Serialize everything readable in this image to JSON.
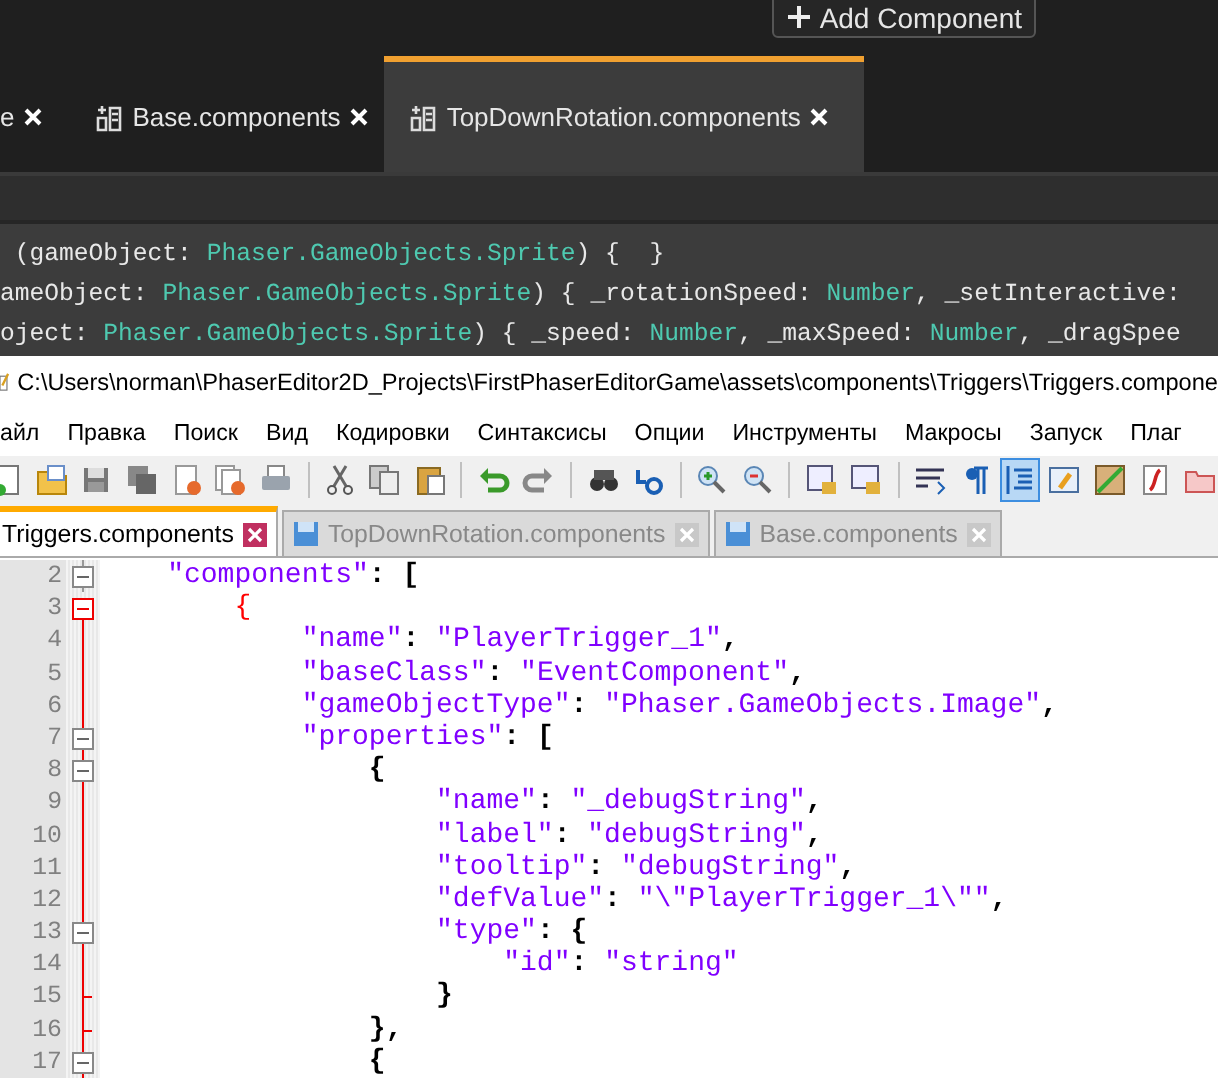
{
  "phaser": {
    "add_button": {
      "label": "Add Component"
    },
    "tabs": [
      {
        "label": "e",
        "has_icon": false,
        "selected": false
      },
      {
        "label": "Base.components",
        "has_icon": true,
        "selected": false
      },
      {
        "label": "TopDownRotation.components",
        "has_icon": true,
        "selected": true
      }
    ],
    "code_lines": [
      [
        {
          "kind": "plain",
          "text": " (gameObject: "
        },
        {
          "kind": "type",
          "text": "Phaser.GameObjects.Sprite"
        },
        {
          "kind": "plain",
          "text": ") {  }"
        }
      ],
      [
        {
          "kind": "plain",
          "text": "ameObject: "
        },
        {
          "kind": "type",
          "text": "Phaser.GameObjects.Sprite"
        },
        {
          "kind": "plain",
          "text": ") { _rotationSpeed: "
        },
        {
          "kind": "type",
          "text": "Number"
        },
        {
          "kind": "plain",
          "text": ", _setInteractive:"
        }
      ],
      [
        {
          "kind": "plain",
          "text": "oject: "
        },
        {
          "kind": "type",
          "text": "Phaser.GameObjects.Sprite"
        },
        {
          "kind": "plain",
          "text": ") { _speed: "
        },
        {
          "kind": "type",
          "text": "Number"
        },
        {
          "kind": "plain",
          "text": ", _maxSpeed: "
        },
        {
          "kind": "type",
          "text": "Number"
        },
        {
          "kind": "plain",
          "text": ", _dragSpee"
        }
      ]
    ]
  },
  "npp": {
    "title": "C:\\Users\\norman\\PhaserEditor2D_Projects\\FirstPhaserEditorGame\\assets\\components\\Triggers\\Triggers.compone",
    "menu": [
      "айл",
      "Правка",
      "Поиск",
      "Вид",
      "Кодировки",
      "Синтаксисы",
      "Опции",
      "Инструменты",
      "Макросы",
      "Запуск",
      "Плаг"
    ],
    "toolbar": [
      {
        "kind": "new",
        "selected": false
      },
      {
        "kind": "open",
        "selected": false
      },
      {
        "kind": "save",
        "selected": false
      },
      {
        "kind": "save-all",
        "selected": false
      },
      {
        "kind": "close",
        "selected": false
      },
      {
        "kind": "close-all",
        "selected": false
      },
      {
        "kind": "print",
        "selected": false
      },
      {
        "kind": "sep"
      },
      {
        "kind": "cut",
        "selected": false
      },
      {
        "kind": "copy",
        "selected": false
      },
      {
        "kind": "paste",
        "selected": false
      },
      {
        "kind": "sep"
      },
      {
        "kind": "undo",
        "selected": false
      },
      {
        "kind": "redo",
        "selected": false
      },
      {
        "kind": "sep"
      },
      {
        "kind": "find",
        "selected": false
      },
      {
        "kind": "replace",
        "selected": false
      },
      {
        "kind": "sep"
      },
      {
        "kind": "zoom-in",
        "selected": false
      },
      {
        "kind": "zoom-out",
        "selected": false
      },
      {
        "kind": "sep"
      },
      {
        "kind": "sync-v",
        "selected": false
      },
      {
        "kind": "sync-h",
        "selected": false
      },
      {
        "kind": "sep"
      },
      {
        "kind": "wrap",
        "selected": false
      },
      {
        "kind": "pilcrow",
        "selected": false
      },
      {
        "kind": "indent-guide",
        "selected": true
      },
      {
        "kind": "udl",
        "selected": false
      },
      {
        "kind": "map",
        "selected": false
      },
      {
        "kind": "func",
        "selected": false
      },
      {
        "kind": "folder",
        "selected": false
      }
    ],
    "tabs": [
      {
        "label": "Triggers.components",
        "selected": true
      },
      {
        "label": "TopDownRotation.components",
        "selected": false
      },
      {
        "label": "Base.components",
        "selected": false
      }
    ],
    "lines": [
      {
        "number": "2",
        "kind": "open",
        "in_block": false,
        "tokens": [
          {
            "kind": "string",
            "text": "    \"components\""
          },
          {
            "kind": "punct",
            "text": ": ["
          }
        ]
      },
      {
        "number": "3",
        "kind": "open_active",
        "in_block": true,
        "tokens": [
          {
            "kind": "match",
            "text": "        {"
          }
        ]
      },
      {
        "number": "4",
        "kind": "line",
        "in_block": true,
        "tokens": [
          {
            "kind": "string",
            "text": "            \"name\""
          },
          {
            "kind": "punct",
            "text": ": "
          },
          {
            "kind": "string",
            "text": "\"PlayerTrigger_1\""
          },
          {
            "kind": "punct",
            "text": ","
          }
        ]
      },
      {
        "number": "5",
        "kind": "line",
        "in_block": true,
        "tokens": [
          {
            "kind": "string",
            "text": "            \"baseClass\""
          },
          {
            "kind": "punct",
            "text": ": "
          },
          {
            "kind": "string",
            "text": "\"EventComponent\""
          },
          {
            "kind": "punct",
            "text": ","
          }
        ]
      },
      {
        "number": "6",
        "kind": "line",
        "in_block": true,
        "tokens": [
          {
            "kind": "string",
            "text": "            \"gameObjectType\""
          },
          {
            "kind": "punct",
            "text": ": "
          },
          {
            "kind": "string",
            "text": "\"Phaser.GameObjects.Image\""
          },
          {
            "kind": "punct",
            "text": ","
          }
        ]
      },
      {
        "number": "7",
        "kind": "open",
        "in_block": true,
        "tokens": [
          {
            "kind": "string",
            "text": "            \"properties\""
          },
          {
            "kind": "punct",
            "text": ": ["
          }
        ]
      },
      {
        "number": "8",
        "kind": "open",
        "in_block": true,
        "tokens": [
          {
            "kind": "punct",
            "text": "                {"
          }
        ]
      },
      {
        "number": "9",
        "kind": "line",
        "in_block": true,
        "tokens": [
          {
            "kind": "string",
            "text": "                    \"name\""
          },
          {
            "kind": "punct",
            "text": ": "
          },
          {
            "kind": "string",
            "text": "\"_debugString\""
          },
          {
            "kind": "punct",
            "text": ","
          }
        ]
      },
      {
        "number": "10",
        "kind": "line",
        "in_block": true,
        "tokens": [
          {
            "kind": "string",
            "text": "                    \"label\""
          },
          {
            "kind": "punct",
            "text": ": "
          },
          {
            "kind": "string",
            "text": "\"debugString\""
          },
          {
            "kind": "punct",
            "text": ","
          }
        ]
      },
      {
        "number": "11",
        "kind": "line",
        "in_block": true,
        "tokens": [
          {
            "kind": "string",
            "text": "                    \"tooltip\""
          },
          {
            "kind": "punct",
            "text": ": "
          },
          {
            "kind": "string",
            "text": "\"debugString\""
          },
          {
            "kind": "punct",
            "text": ","
          }
        ]
      },
      {
        "number": "12",
        "kind": "line",
        "in_block": true,
        "tokens": [
          {
            "kind": "string",
            "text": "                    \"defValue\""
          },
          {
            "kind": "punct",
            "text": ": "
          },
          {
            "kind": "string",
            "text": "\"\\\"PlayerTrigger_1\\\"\""
          },
          {
            "kind": "punct",
            "text": ","
          }
        ]
      },
      {
        "number": "13",
        "kind": "open",
        "in_block": true,
        "tokens": [
          {
            "kind": "string",
            "text": "                    \"type\""
          },
          {
            "kind": "punct",
            "text": ": {"
          }
        ]
      },
      {
        "number": "14",
        "kind": "line",
        "in_block": true,
        "tokens": [
          {
            "kind": "string",
            "text": "                        \"id\""
          },
          {
            "kind": "punct",
            "text": ": "
          },
          {
            "kind": "string",
            "text": "\"string\""
          }
        ]
      },
      {
        "number": "15",
        "kind": "end",
        "in_block": true,
        "tokens": [
          {
            "kind": "punct",
            "text": "                    }"
          }
        ]
      },
      {
        "number": "16",
        "kind": "end",
        "in_block": true,
        "tokens": [
          {
            "kind": "punct",
            "text": "                },"
          }
        ]
      },
      {
        "number": "17",
        "kind": "open",
        "in_block": true,
        "tokens": [
          {
            "kind": "punct",
            "text": "                {"
          }
        ]
      }
    ]
  }
}
